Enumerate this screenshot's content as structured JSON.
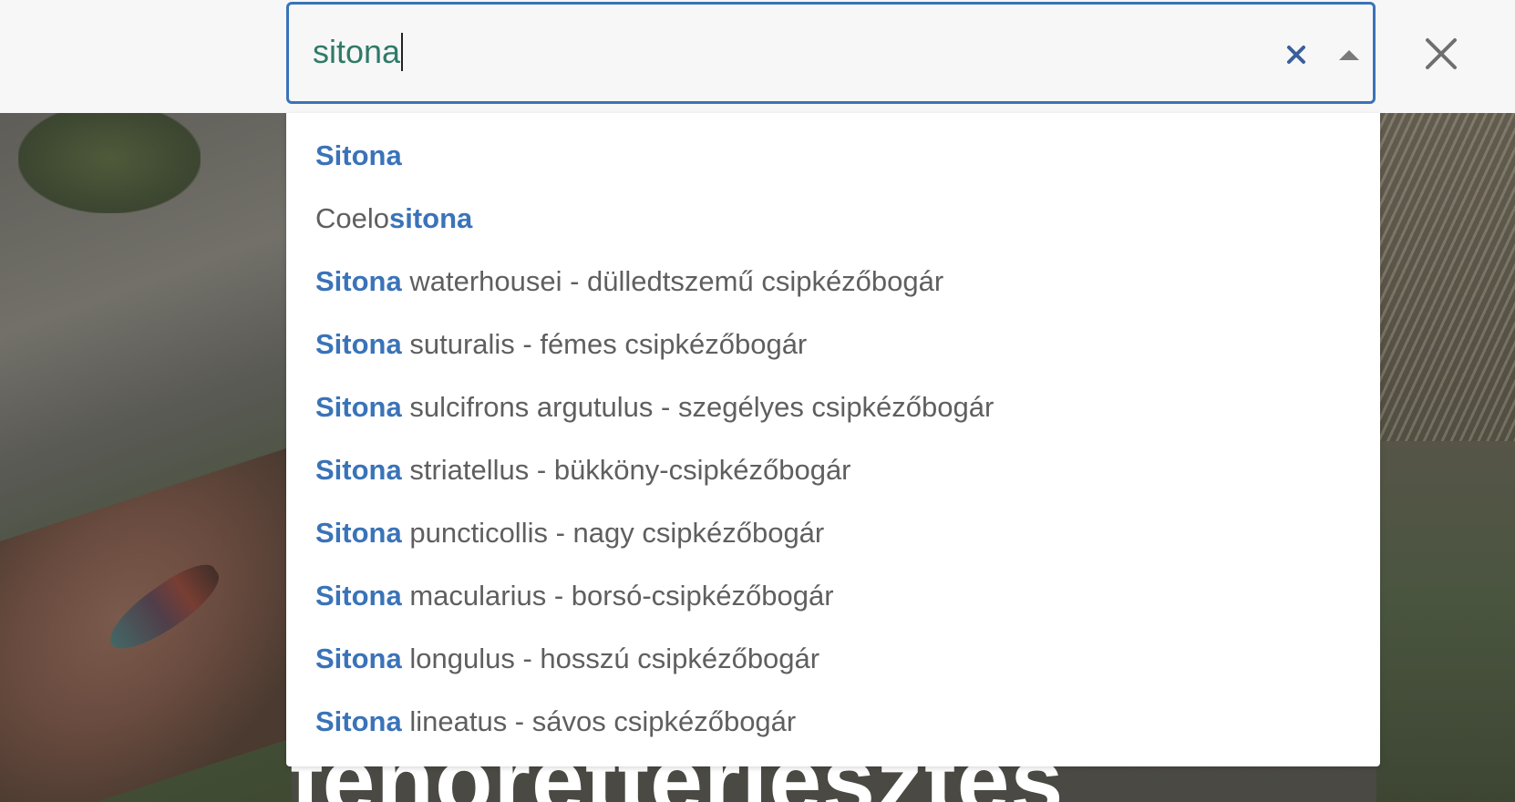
{
  "search": {
    "value": "sitona",
    "clear_icon": "close-x-icon",
    "toggle_icon": "caret-up-icon"
  },
  "close_icon": "close-icon",
  "background_heading": "fenoretterjesztes",
  "dropdown": {
    "options": [
      {
        "prefix": "",
        "match": "Sitona",
        "rest": ""
      },
      {
        "prefix": "Coelo",
        "match": "sitona",
        "rest": ""
      },
      {
        "prefix": "",
        "match": "Sitona",
        "rest": " waterhousei - dülledtszemű csipkézőbogár"
      },
      {
        "prefix": "",
        "match": "Sitona",
        "rest": " suturalis - fémes csipkézőbogár"
      },
      {
        "prefix": "",
        "match": "Sitona",
        "rest": " sulcifrons argutulus - szegélyes csipkézőbogár"
      },
      {
        "prefix": "",
        "match": "Sitona",
        "rest": " striatellus - bükköny-csipkézőbogár"
      },
      {
        "prefix": "",
        "match": "Sitona",
        "rest": " puncticollis - nagy csipkézőbogár"
      },
      {
        "prefix": "",
        "match": "Sitona",
        "rest": " macularius - borsó-csipkézőbogár"
      },
      {
        "prefix": "",
        "match": "Sitona",
        "rest": " longulus - hosszú csipkézőbogár"
      },
      {
        "prefix": "",
        "match": "Sitona",
        "rest": " lineatus - sávos csipkézőbogár"
      }
    ]
  },
  "colors": {
    "accent": "#3a73b8",
    "input_text": "#2f7a68",
    "option_text": "#5f5f5f"
  }
}
